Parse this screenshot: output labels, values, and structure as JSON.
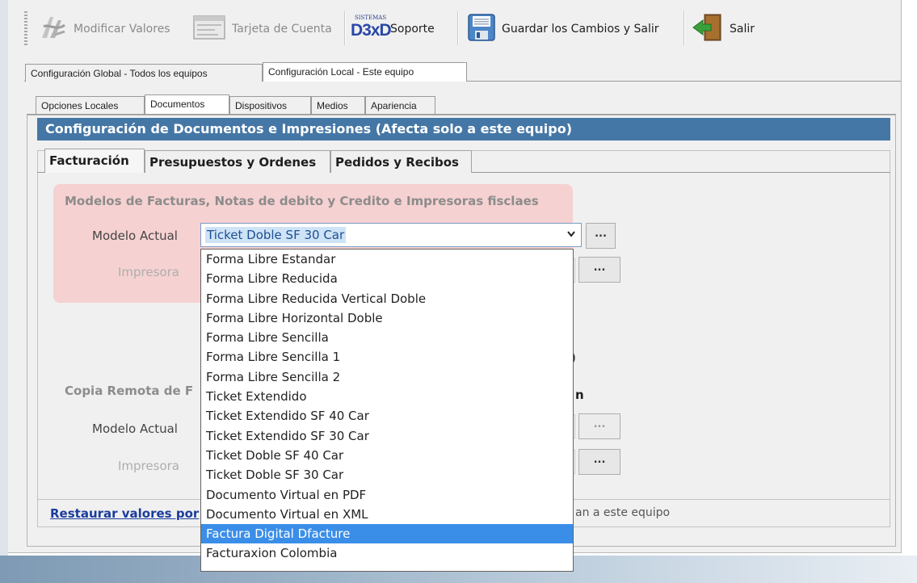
{
  "toolbar": {
    "modify_values": "Modificar Valores",
    "account_card": "Tarjeta de Cuenta",
    "support_logo_small": "SISTEMAS",
    "support_logo_big": "D3xD",
    "support": "Soporte",
    "save_exit": "Guardar los Cambios  y Salir",
    "exit": "Salir"
  },
  "main_tabs": [
    "Configuración Global - Todos los equipos",
    "Configuración Local - Este equipo"
  ],
  "sub_tabs": [
    "Opciones Locales",
    "Documentos",
    "Dispositivos",
    "Medios",
    "Apariencia"
  ],
  "section_header": "Configuración de Documentos e Impresiones (Afecta solo a este equipo)",
  "doc_tabs": [
    "Facturación",
    "Presupuestos y Ordenes",
    "Pedidos y Recibos"
  ],
  "invoice_group": {
    "title": "Modelos de Facturas, Notas de debito y Credito e Impresoras fisclaes",
    "model_label": "Modelo Actual",
    "printer_label": "Impresora",
    "model_value": "Ticket Doble SF 30 Car",
    "browse_label": "..."
  },
  "remote_group": {
    "title": "Copia Remota de F",
    "title_tail": "n",
    "model_label": "Modelo Actual",
    "printer_label": "Impresora",
    "stray_char": ")"
  },
  "footer": {
    "restore_link": "Restaurar valores por",
    "note_tail": "an a este equipo"
  },
  "dropdown": {
    "options": [
      "Forma Libre Estandar",
      "Forma Libre Reducida",
      "Forma Libre Reducida Vertical Doble",
      "Forma Libre Horizontal Doble",
      "Forma Libre Sencilla",
      "Forma Libre Sencilla 1",
      "Forma Libre Sencilla 2",
      "Ticket Extendido",
      "Ticket Extendido SF 40 Car",
      "Ticket Extendido SF 30 Car",
      "Ticket Doble SF 40 Car",
      "Ticket Doble SF 30 Car",
      "Documento Virtual en PDF",
      "Documento Virtual en XML",
      "Factura Digital Dfacture",
      "Facturaxion Colombia"
    ],
    "highlighted": "Factura Digital Dfacture"
  },
  "colors": {
    "header_blue": "#4577a6",
    "selection_blue": "#3b8ee8",
    "pink_highlight": "#f6d1d1",
    "link_blue": "#1a3c9c"
  },
  "icons": [
    "modify-values-icon",
    "account-card-icon",
    "support-logo-icon",
    "save-floppy-icon",
    "exit-door-icon",
    "chevron-down-icon"
  ]
}
